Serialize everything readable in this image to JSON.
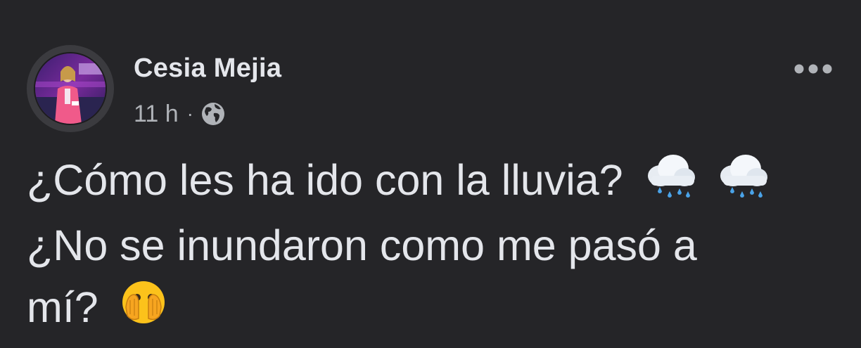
{
  "post": {
    "author": "Cesia Mejia",
    "time": "11 h",
    "separator": "·",
    "visibility_icon": "globe-icon",
    "more_icon": "more-options-icon",
    "text_lines": [
      "¿Cómo les ha ido con la lluvia?",
      "¿No se inundaron como me pasó a",
      "mí?"
    ],
    "emojis": {
      "line1": [
        "cloud-with-rain-emoji",
        "cloud-with-rain-emoji"
      ],
      "line3": [
        "face-with-open-eyes-and-hand-over-mouth-emoji"
      ]
    }
  },
  "colors": {
    "background": "#252528",
    "primary_text": "#e4e6eb",
    "secondary_text": "#b0b3b8"
  }
}
